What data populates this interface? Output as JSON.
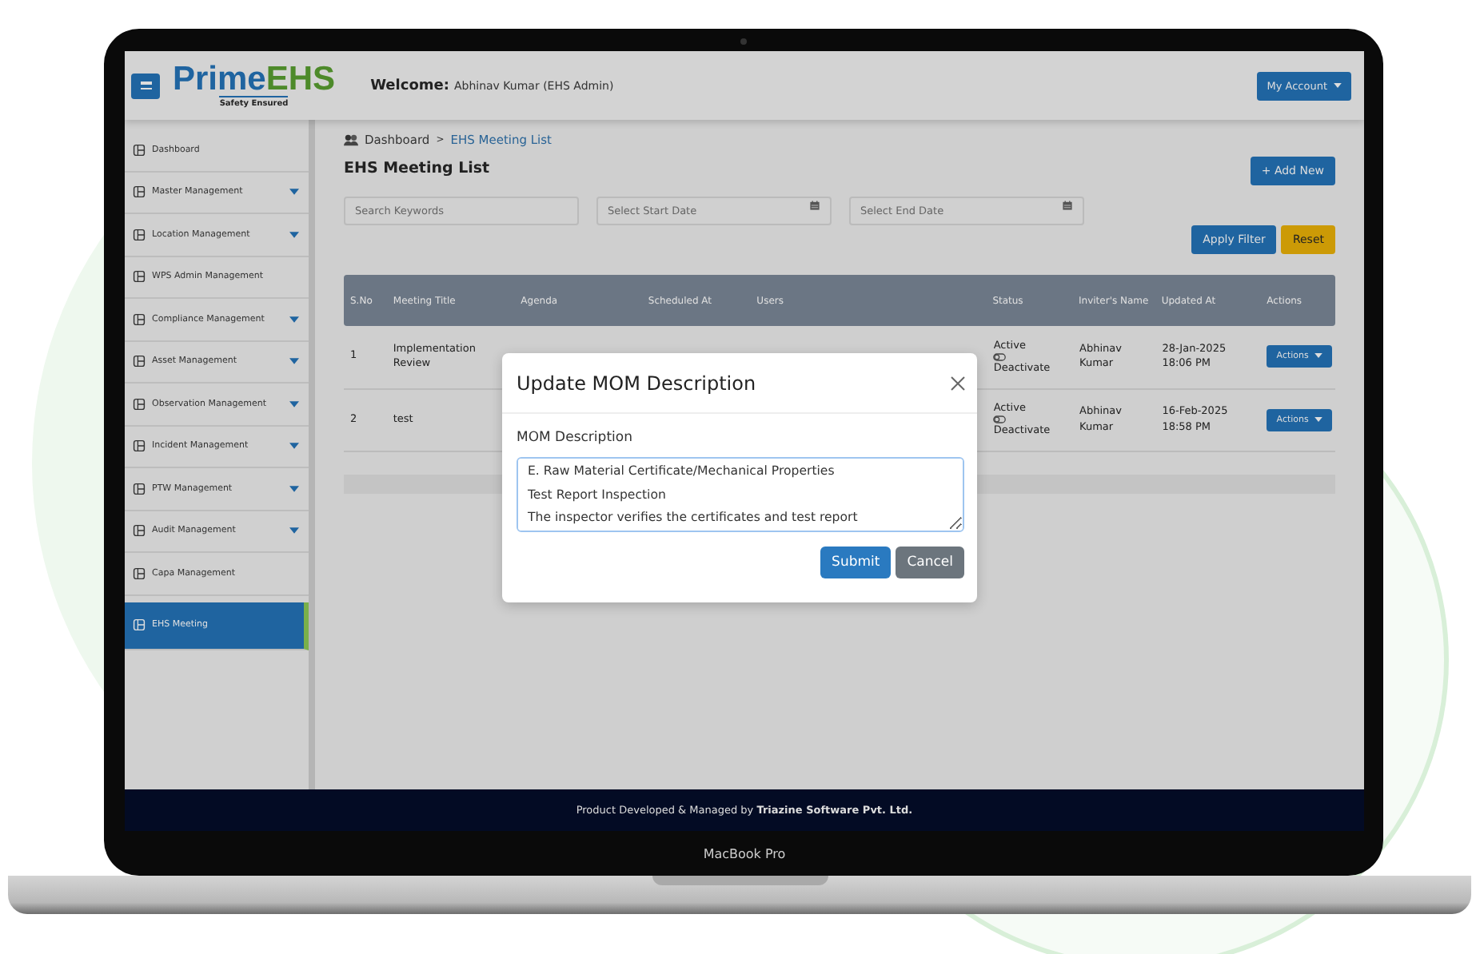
{
  "header": {
    "logo_prime": "Prime",
    "logo_ehs": "EHS",
    "logo_tagline": "Safety Ensured",
    "welcome_label": "Welcome:",
    "welcome_user": "Abhinav Kumar (EHS Admin)",
    "account_button": "My Account"
  },
  "sidebar": {
    "items": [
      {
        "label": "Dashboard",
        "has_menu": false,
        "selected": false
      },
      {
        "label": "Master Management",
        "has_menu": true,
        "selected": false
      },
      {
        "label": "Location Management",
        "has_menu": true,
        "selected": false
      },
      {
        "label": "WPS Admin Management",
        "has_menu": false,
        "selected": false
      },
      {
        "label": "Compliance Management",
        "has_menu": true,
        "selected": false
      },
      {
        "label": "Asset Management",
        "has_menu": true,
        "selected": false
      },
      {
        "label": "Observation Management",
        "has_menu": true,
        "selected": false
      },
      {
        "label": "Incident Management",
        "has_menu": true,
        "selected": false
      },
      {
        "label": "PTW Management",
        "has_menu": true,
        "selected": false
      },
      {
        "label": "Audit Management",
        "has_menu": true,
        "selected": false
      },
      {
        "label": "Capa Management",
        "has_menu": false,
        "selected": false
      },
      {
        "label": "EHS Meeting",
        "has_menu": false,
        "selected": true
      }
    ]
  },
  "breadcrumb": {
    "items": [
      {
        "label": "Dashboard",
        "selected": false
      },
      {
        "label": "EHS Meeting List",
        "selected": true
      }
    ],
    "separator": ">"
  },
  "page_title": "EHS Meeting List",
  "add_button": "+ Add New",
  "filters": [
    {
      "placeholder": "Search Keywords",
      "kind": "text"
    },
    {
      "placeholder": "Select Start Date",
      "kind": "date"
    },
    {
      "placeholder": "Select End Date",
      "kind": "date"
    }
  ],
  "filter_buttons": [
    {
      "label": "Apply Filter",
      "kind": "primary"
    },
    {
      "label": "Reset",
      "kind": "warning"
    }
  ],
  "table": {
    "columns": [
      "S.No",
      "Meeting Title",
      "Agenda",
      "Scheduled At",
      "Users",
      "Status",
      "Inviter's Name",
      "Updated At",
      "Actions"
    ],
    "rows": [
      {
        "s_no": "1",
        "meeting_title": "Implementation Review",
        "status": "Active",
        "toggle_label": "Deactivate",
        "inviter": "Abhinav Kumar",
        "updated_at": [
          "28-Jan-2025",
          "18:06 PM"
        ],
        "action": "Actions"
      },
      {
        "s_no": "2",
        "meeting_title": "test",
        "status": "Active",
        "toggle_label": "Deactivate",
        "inviter": "Abhinav Kumar",
        "updated_at": [
          "16-Feb-2025",
          "18:58 PM"
        ],
        "action": "Actions"
      }
    ]
  },
  "modal": {
    "title": "Update MOM Description",
    "field_label": "MOM Description",
    "value": "E. Raw Material Certificate/Mechanical Properties\nTest Report Inspection\nThe inspector verifies the certificates and test report",
    "buttons": [
      {
        "label": "Submit",
        "kind": "primary"
      },
      {
        "label": "Cancel",
        "kind": "secondary"
      }
    ]
  },
  "footer": "Product Developed & Managed by **Triazine Software Pvt. Ltd.**",
  "device_label": "MacBook Pro"
}
